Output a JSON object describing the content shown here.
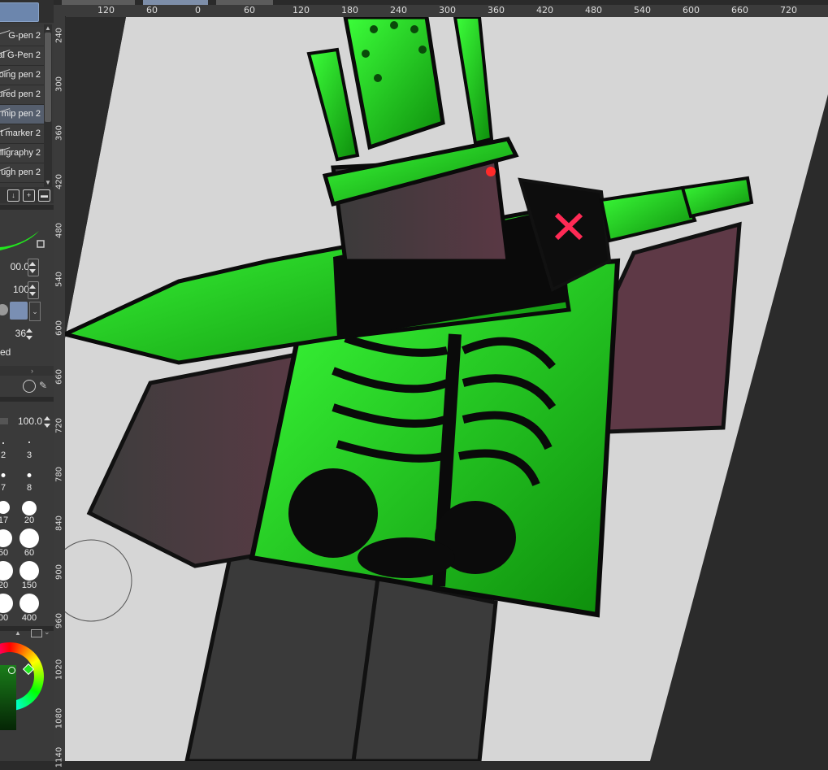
{
  "brush_list": [
    {
      "label": "G-pen 2"
    },
    {
      "label": "al G-Pen 2"
    },
    {
      "label": "oing pen 2"
    },
    {
      "label": "ured pen 2"
    },
    {
      "label": "mip pen 2",
      "selected": true
    },
    {
      "label": "t marker 2"
    },
    {
      "label": "lligraphy 2"
    },
    {
      "label": "ugh pen 2"
    }
  ],
  "tool_props": {
    "brush_size": "00.0",
    "opacity": "100",
    "count": "36",
    "mode_text": "ed"
  },
  "layer": {
    "opacity": "100.0"
  },
  "brush_sizes": [
    "2",
    "3",
    "7",
    "8",
    "17",
    "20",
    "50",
    "60",
    "20",
    "150",
    "00",
    "400"
  ],
  "ruler_h": [
    "120",
    "60",
    "0",
    "60",
    "120",
    "180",
    "240",
    "300",
    "360",
    "420",
    "480",
    "540",
    "600",
    "660",
    "720"
  ],
  "ruler_v": [
    "240",
    "300",
    "360",
    "420",
    "480",
    "540",
    "600",
    "660",
    "720",
    "780",
    "840",
    "900",
    "960",
    "1020",
    "1080",
    "1140"
  ],
  "colors": {
    "accent_green": "#22e61e",
    "dark_green": "#0a5a08",
    "panel_bg": "#3a3a3a",
    "canvas_paper": "#d6d6d6",
    "x_mark": "#ff2a55"
  },
  "icons": {
    "wheel": "color-wheel-icon"
  }
}
